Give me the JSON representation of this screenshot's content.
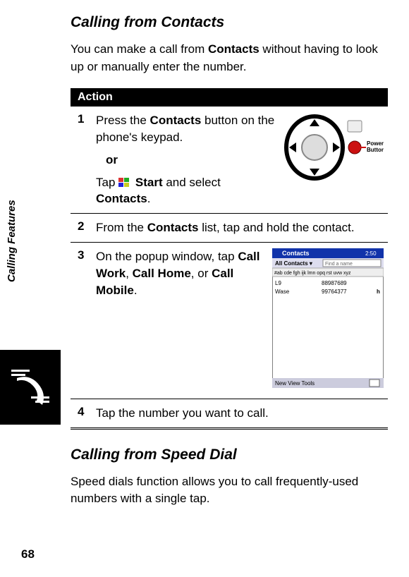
{
  "sidebar": {
    "section_label": "Calling Features",
    "page_number": "68"
  },
  "section1": {
    "title": "Calling from Contacts",
    "intro_pre": "You can make a call from ",
    "intro_bold": "Contacts",
    "intro_post": " without having to look up or manually enter the number."
  },
  "table": {
    "header": "Action",
    "step1": {
      "num": "1",
      "pre": "Press the ",
      "bold1": "Contacts",
      "mid": " button on the phone's keypad.",
      "or": "or",
      "tap": "Tap ",
      "start": "Start",
      "and_select": " and select ",
      "bold2": "Contacts",
      "period": ".",
      "illus_label": "Power/End Button"
    },
    "step2": {
      "num": "2",
      "pre": "From the ",
      "bold": "Contacts",
      "post": " list, tap and hold the contact."
    },
    "step3": {
      "num": "3",
      "pre": "On the popup window, tap ",
      "b1": "Call Work",
      "c1": ", ",
      "b2": "Call Home",
      "c2": ", or ",
      "b3": "Call Mobile",
      "post": ".",
      "screen": {
        "title": "Contacts",
        "time": "2:50",
        "filter": "All Contacts",
        "search_label": "Find a name",
        "row_a": "L9",
        "row_a_num": "88987689",
        "row_b": "Wase",
        "row_b_num": "99764377",
        "menu": "New  View  Tools"
      }
    },
    "step4": {
      "num": "4",
      "text": "Tap the number you want to call."
    }
  },
  "section2": {
    "title": "Calling from Speed Dial",
    "intro": "Speed dials function allows you to call frequently-used numbers with a single tap."
  }
}
